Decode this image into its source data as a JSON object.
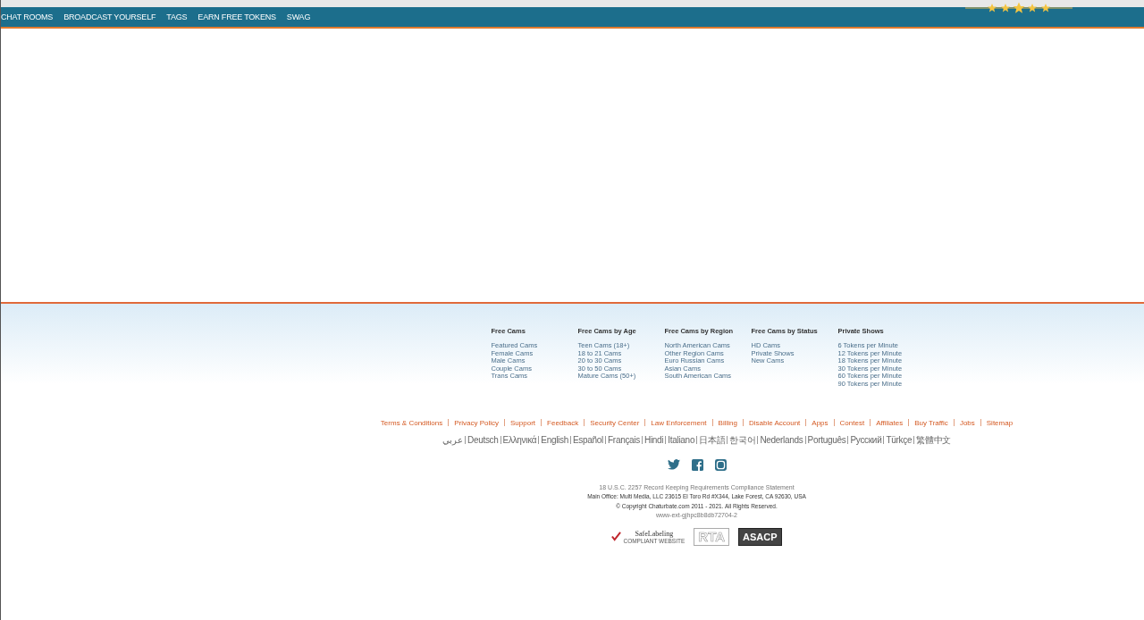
{
  "nav": {
    "items": [
      "CHAT ROOMS",
      "BROADCAST YOURSELF",
      "TAGS",
      "EARN FREE TOKENS",
      "SWAG"
    ]
  },
  "footer": {
    "columns": [
      {
        "heading": "Free Cams",
        "links": [
          "Featured Cams",
          "Female Cams",
          "Male Cams",
          "Couple Cams",
          "Trans Cams"
        ]
      },
      {
        "heading": "Free Cams by Age",
        "links": [
          "Teen Cams (18+)",
          "18 to 21 Cams",
          "20 to 30 Cams",
          "30 to 50 Cams",
          "Mature Cams (50+)"
        ]
      },
      {
        "heading": "Free Cams by Region",
        "links": [
          "North American Cams",
          "Other Region Cams",
          "Euro Russian Cams",
          "Asian Cams",
          "South American Cams"
        ]
      },
      {
        "heading": "Free Cams by Status",
        "links": [
          "HD Cams",
          "Private Shows",
          "New Cams"
        ]
      },
      {
        "heading": "Private Shows",
        "links": [
          "6 Tokens per Minute",
          "12 Tokens per Minute",
          "18 Tokens per Minute",
          "30 Tokens per Minute",
          "60 Tokens per Minute",
          "90 Tokens per Minute"
        ]
      }
    ],
    "links": [
      "Terms & Conditions",
      "Privacy Policy",
      "Support",
      "Feedback",
      "Security Center",
      "Law Enforcement",
      "Billing",
      "Disable Account",
      "Apps",
      "Contest",
      "Affiliates",
      "Buy Traffic",
      "Jobs",
      "Sitemap"
    ],
    "languages": [
      "عربي",
      "Deutsch",
      "Ελληνικά",
      "English",
      "Español",
      "Français",
      "Hindi",
      "Italiano",
      "日本語",
      "한국어",
      "Nederlands",
      "Português",
      "Русский",
      "Türkçe",
      "繁體中文"
    ],
    "social": [
      {
        "kind": "twitter"
      },
      {
        "kind": "facebook"
      },
      {
        "kind": "instagram"
      }
    ],
    "legal": [
      "18 U.S.C. 2257 Record Keeping Requirements Compliance Statement",
      "Main Office: Multi Media, LLC 23615 El Toro Rd #X344, Lake Forest, CA 92630, USA",
      "© Copyright Chaturbate.com 2011 - 2021. All Rights Reserved.",
      "www-ext-gjhpc8b8db72704-2"
    ],
    "badges": [
      {
        "kind": "safelabeling",
        "title": "SafeLabeling",
        "subtitle": "COMPLIANT WEBSITE"
      },
      {
        "kind": "rta",
        "title": "RTA"
      },
      {
        "kind": "asacp",
        "title": "ASACP"
      }
    ]
  }
}
